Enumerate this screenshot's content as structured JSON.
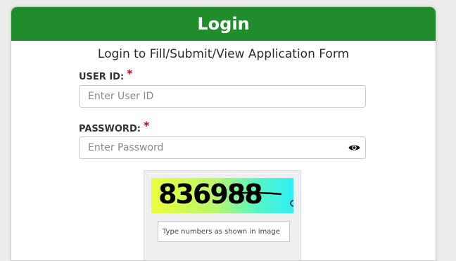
{
  "header": {
    "title": "Login",
    "color": "#218c2c"
  },
  "subtitle": "Login to Fill/Submit/View Application Form",
  "user_id": {
    "label": "USER ID:",
    "required_mark": "*",
    "placeholder": "Enter User ID"
  },
  "password": {
    "label": "PASSWORD:",
    "required_mark": "*",
    "placeholder": "Enter Password",
    "toggle_icon": "eye-icon"
  },
  "captcha": {
    "code": "836988",
    "refresh_icon": "refresh-icon",
    "placeholder": "Type numbers as shown in image"
  }
}
